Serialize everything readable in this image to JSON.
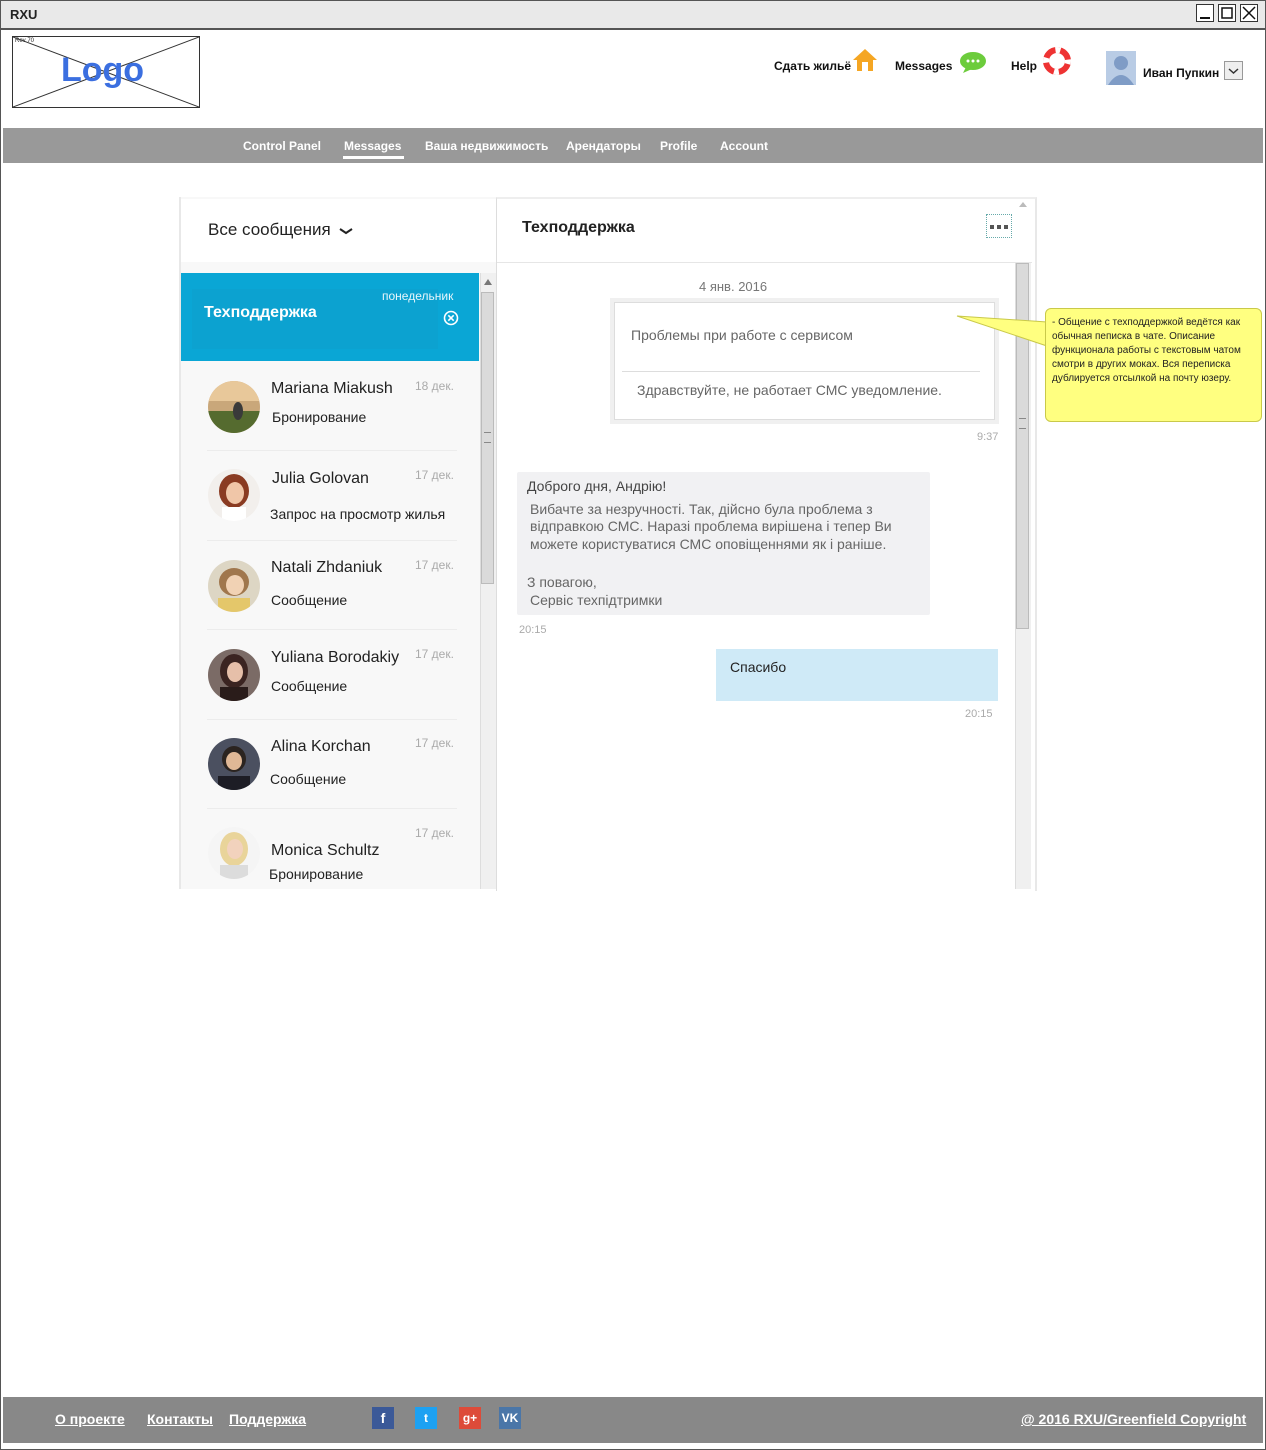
{
  "window": {
    "title": "RXU"
  },
  "header": {
    "logo_text": "Logo",
    "logo_small": "Rev 70",
    "rent_out_label": "Сдать жильё",
    "messages_label": "Messages",
    "help_label": "Help",
    "user_name": "Иван Пупкин"
  },
  "nav": {
    "items": [
      "Control Panel",
      "Messages",
      "Ваша недвижимость",
      "Арендаторы",
      "Profile",
      "Account"
    ],
    "active": "Messages"
  },
  "inbox": {
    "filter_label": "Все сообщения",
    "selected": {
      "name": "Техподдержка",
      "date": "понедельник"
    },
    "conversations": [
      {
        "name": "Mariana Miakush",
        "date": "18 дек.",
        "subject": "Бронирование"
      },
      {
        "name": "Julia Golovan",
        "date": "17 дек.",
        "subject": "Запрос на просмотр жилья"
      },
      {
        "name": "Natali Zhdaniuk",
        "date": "17 дек.",
        "subject": "Сообщение"
      },
      {
        "name": "Yuliana Borodakiy",
        "date": "17 дек.",
        "subject": "Сообщение"
      },
      {
        "name": "Alina Korchan",
        "date": "17 дек.",
        "subject": "Сообщение"
      },
      {
        "name": "Monica Schultz",
        "date": "17 дек.",
        "subject": "Бронирование"
      }
    ]
  },
  "chat": {
    "title": "Техподдержка",
    "date_separator": "4 янв. 2016",
    "ticket": {
      "subject": "Проблемы при работе с сервисом",
      "body": "Здравствуйте, не работает СМС уведомление.",
      "time": "9:37"
    },
    "reply": {
      "greeting": "Доброго дня, Андрію!",
      "lines": [
        "Вибачте за незручності. Так, дійсно була проблема з",
        "відправкою СМС. Наразі проблема вирішена і тепер Ви",
        "можете користуватися СМС оповіщеннями як і раніше."
      ],
      "sign1": "З повагою,",
      "sign2": "Сервіс техпідтримки",
      "time": "20:15"
    },
    "own": {
      "text": "Спасибо",
      "time": "20:15"
    }
  },
  "annotation": {
    "text": "- Общение с техподдержкой ведётся как обычная пеписка в чате. Описание функционала работы с текстовым чатом смотри в других моках. Вся переписка дублируется отсылкой на почту юзеру."
  },
  "footer": {
    "links": [
      "О проекте",
      "Контакты",
      "Поддержка"
    ],
    "social": [
      "f",
      "t",
      "g+",
      "VK"
    ],
    "copyright": "@ 2016 RXU/Greenfield Copyright"
  },
  "colors": {
    "accent": "#0aa6d5",
    "nav": "#999999",
    "footer": "#888888",
    "own_bubble": "#cfeaf7",
    "note": "#ffff80"
  }
}
